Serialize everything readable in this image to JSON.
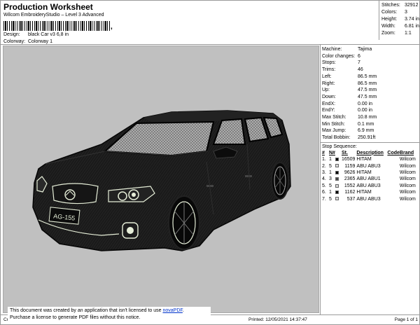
{
  "header": {
    "title": "Production Worksheet",
    "subtitle": "Wilcom EmbroideryStudio – Level 3 Advanced",
    "barcode_suffix": ",",
    "design_label": "Design:",
    "design_value": "black Car v3 6,8 in",
    "colorway_label": "Colorway:",
    "colorway_value": "Colorway 1"
  },
  "summary": [
    {
      "k": "Stitches:",
      "v": "32912"
    },
    {
      "k": "Colors:",
      "v": "3"
    },
    {
      "k": "Height:",
      "v": "3.74 in"
    },
    {
      "k": "Width:",
      "v": "6.81 in"
    },
    {
      "k": "Zoom:",
      "v": "1:1"
    }
  ],
  "stats": [
    {
      "k": "Machine:",
      "v": "Tajima"
    },
    {
      "k": "Color changes:",
      "v": "6"
    },
    {
      "k": "Stops:",
      "v": "7"
    },
    {
      "k": "Trims:",
      "v": "46"
    },
    {
      "k": "Left:",
      "v": "86.5 mm"
    },
    {
      "k": "Right:",
      "v": "86.5 mm"
    },
    {
      "k": "Up:",
      "v": "47.5 mm"
    },
    {
      "k": "Down:",
      "v": "47.5 mm"
    },
    {
      "k": "EndX:",
      "v": "0.00 in"
    },
    {
      "k": "EndY:",
      "v": "0.00 in"
    },
    {
      "k": "Max Stitch:",
      "v": "10.8 mm"
    },
    {
      "k": "Min Stitch:",
      "v": "0.1 mm"
    },
    {
      "k": "Max Jump:",
      "v": "6.9 mm"
    },
    {
      "k": "Total Bobbin:",
      "v": "250.91ft"
    }
  ],
  "sequence": {
    "title": "Stop Sequence:",
    "headers": {
      "num": "#",
      "n": "N#",
      "st": "St.",
      "desc": "Description",
      "code": "Code",
      "brand": "Brand"
    },
    "rows": [
      {
        "num": "1.",
        "n": "1",
        "color": "#000000",
        "st": "16509",
        "desc": "HITAM",
        "code": "",
        "brand": "Wilcom"
      },
      {
        "num": "2.",
        "n": "5",
        "color": "#d8d8d8",
        "st": "1159",
        "desc": "ABU ABU3",
        "code": "",
        "brand": "Wilcom"
      },
      {
        "num": "3.",
        "n": "1",
        "color": "#000000",
        "st": "9626",
        "desc": "HITAM",
        "code": "",
        "brand": "Wilcom"
      },
      {
        "num": "4.",
        "n": "3",
        "color": "#4a4a4a",
        "st": "2365",
        "desc": "ABU ABU1",
        "code": "",
        "brand": "Wilcom"
      },
      {
        "num": "5.",
        "n": "5",
        "color": "#d8d8d8",
        "st": "1552",
        "desc": "ABU ABU3",
        "code": "",
        "brand": "Wilcom"
      },
      {
        "num": "6.",
        "n": "1",
        "color": "#000000",
        "st": "1162",
        "desc": "HITAM",
        "code": "",
        "brand": "Wilcom"
      },
      {
        "num": "7.",
        "n": "5",
        "color": "#d8d8d8",
        "st": "537",
        "desc": "ABU ABU3",
        "code": "",
        "brand": "Wilcom"
      }
    ]
  },
  "design": {
    "plate_text": "AG-155",
    "background": "#c0c0c0",
    "body_color": "#101010",
    "outline_color": "#e6eed8"
  },
  "footer": {
    "cr": "Cr",
    "printed": "Printed: 12/05/2021 14:37:47",
    "page": "Page 1 of 1"
  },
  "pdf_notice": {
    "line1_pre": "This document was created by an application that isn't licensed to use ",
    "link": "novaPDF",
    "line1_post": ".",
    "line2": "Purchase a license to generate PDF files without this notice."
  }
}
